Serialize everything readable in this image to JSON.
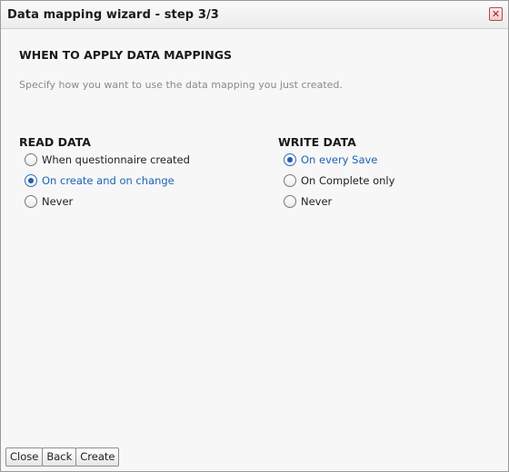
{
  "window": {
    "title": "Data mapping wizard - step 3/3",
    "close_glyph": "✕"
  },
  "main": {
    "heading": "WHEN TO APPLY DATA MAPPINGS",
    "subtitle": "Specify how you want to use the data mapping you just created."
  },
  "read_data": {
    "title": "READ DATA",
    "options": [
      {
        "label": "When questionnaire created",
        "selected": false
      },
      {
        "label": "On create and on change",
        "selected": true
      },
      {
        "label": "Never",
        "selected": false
      }
    ]
  },
  "write_data": {
    "title": "WRITE DATA",
    "options": [
      {
        "label": "On every Save",
        "selected": true
      },
      {
        "label": "On Complete only",
        "selected": false
      },
      {
        "label": "Never",
        "selected": false
      }
    ]
  },
  "footer": {
    "close_label": "Close",
    "back_label": "Back",
    "create_label": "Create"
  },
  "colors": {
    "accent": "#1c63b5",
    "close_icon": "#a42020"
  }
}
